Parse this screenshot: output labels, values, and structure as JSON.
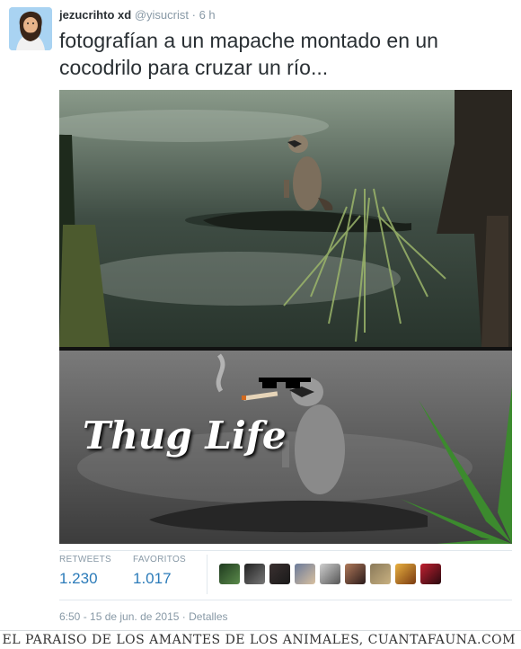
{
  "tweet": {
    "display_name": "jezucrihto xd",
    "handle": "@yisucrist",
    "separator": "·",
    "time": "6 h",
    "text": "fotografían a un mapache montado en un cocodrilo para cruzar un río...",
    "overlay_text": "Thug Life",
    "stats": {
      "retweets_label": "RETWEETS",
      "retweets_value": "1.230",
      "favorites_label": "FAVORITOS",
      "favorites_value": "1.017"
    },
    "timestamp": "6:50 - 15 de jun. de 2015",
    "details_link": "Detalles"
  },
  "footer": {
    "text": "EL PARAISO DE LOS AMANTES DE LOS ANIMALES, CUANTAFAUNA.COM"
  },
  "colors": {
    "link_blue": "#2b7bb9",
    "muted_gray": "#8899a6",
    "text_dark": "#292f33"
  }
}
